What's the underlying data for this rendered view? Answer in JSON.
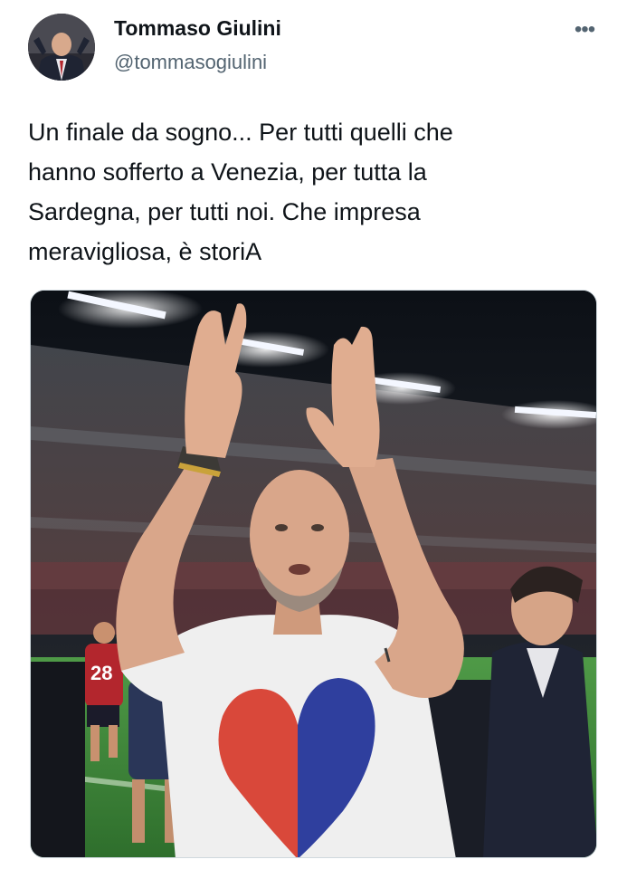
{
  "author": {
    "display_name": "Tommaso Giulini",
    "handle": "@tommasogiulini"
  },
  "more_icon": "more-horizontal-icon",
  "more_glyph": "•••",
  "post": {
    "text": "Un finale da sogno... Per tutti quelli che\nhanno sofferto a Venezia, per tutta la\nSardegna, per tutti noi. Che impresa\nmeravigliosa, è storiA"
  },
  "media": {
    "jersey_number": "28"
  },
  "colors": {
    "text_primary": "#0f1419",
    "text_secondary": "#536471",
    "heart_red": "#d9483a",
    "heart_blue": "#2f3f9e",
    "pitch_green": "#3d8a3a"
  }
}
